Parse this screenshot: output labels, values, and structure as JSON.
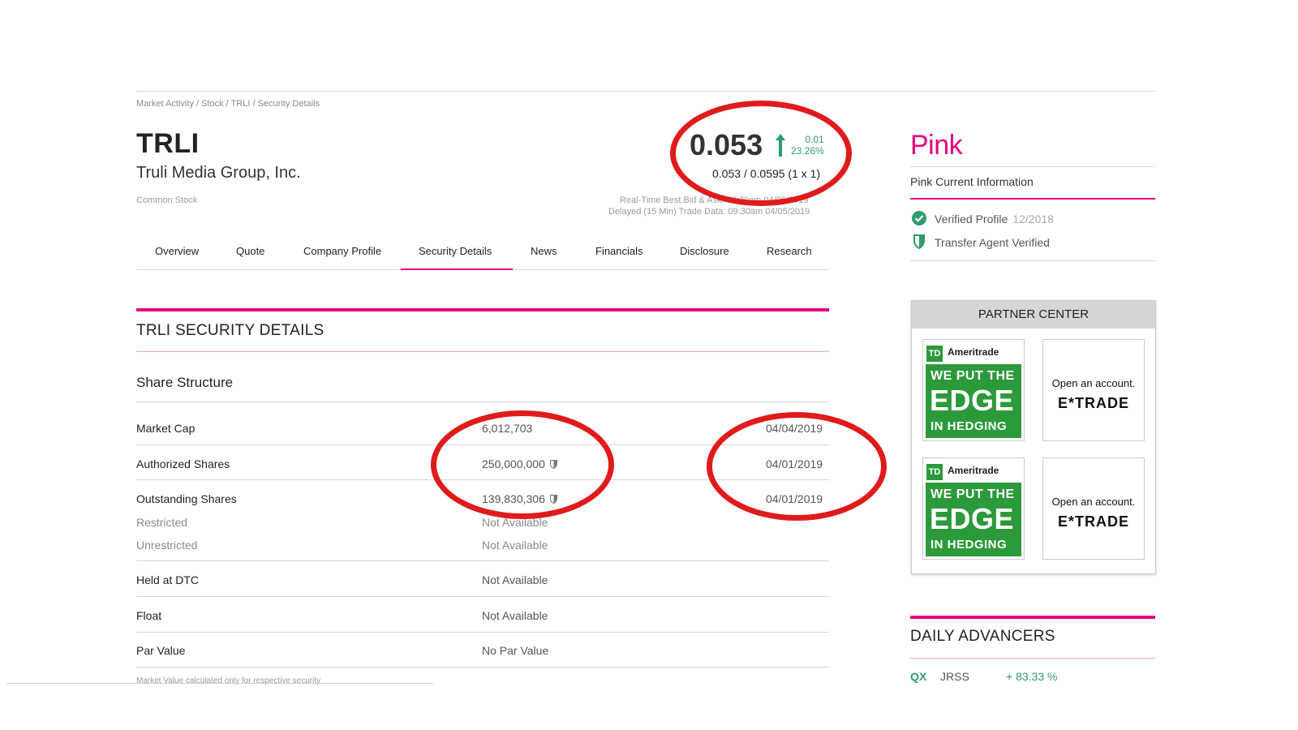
{
  "breadcrumb": [
    "Market Activity",
    "Stock",
    "TRLI",
    "Security Details"
  ],
  "breadcrumb_sep": " / ",
  "header": {
    "ticker": "TRLI",
    "company": "Truli Media Group, Inc.",
    "security_type": "Common Stock",
    "price": "0.053",
    "change": "0.01",
    "change_pct": "23.26%",
    "bid_ask": "0.053 / 0.0595 (1 x 1)",
    "realtime_note": "Real-Time Best Bid & Ask: 09:30am 04/05/2019",
    "delayed_note": "Delayed (15 Min) Trade Data: 09:30am 04/05/2019",
    "up_color": "#2e9d6a"
  },
  "tabs": [
    "Overview",
    "Quote",
    "Company Profile",
    "Security Details",
    "News",
    "Financials",
    "Disclosure",
    "Research"
  ],
  "active_tab": "Security Details",
  "security_details": {
    "title": "TRLI SECURITY DETAILS",
    "share_structure_title": "Share Structure",
    "rows": {
      "market_cap": {
        "label": "Market Cap",
        "value": "6,012,703",
        "date": "04/04/2019"
      },
      "authorized": {
        "label": "Authorized Shares",
        "value": "250,000,000",
        "date": "04/01/2019"
      },
      "outstanding": {
        "label": "Outstanding Shares",
        "value": "139,830,306",
        "date": "04/01/2019"
      },
      "restricted": {
        "label": "Restricted",
        "value": "Not Available"
      },
      "unrestricted": {
        "label": "Unrestricted",
        "value": "Not Available"
      },
      "held_dtc": {
        "label": "Held at DTC",
        "value": "Not Available"
      },
      "float": {
        "label": "Float",
        "value": "Not Available"
      },
      "par_value": {
        "label": "Par Value",
        "value": "No Par Value"
      }
    },
    "footnote": "Market Value calculated only for respective security"
  },
  "sidebar": {
    "tier_logo": "Pink",
    "tier_info": "Pink Current Information",
    "verified_profile": "Verified Profile",
    "verified_date": "12/2018",
    "transfer_agent": "Transfer Agent Verified",
    "brand_color": "#e5007e"
  },
  "partner_center": {
    "title": "PARTNER CENTER",
    "ads": [
      {
        "brand": "Ameritrade",
        "logo": "TD",
        "line1": "WE PUT THE",
        "line2": "EDGE",
        "line3": "IN HEDGING"
      },
      {
        "line1": "Open an account.",
        "brand": "E*TRADE"
      },
      {
        "brand": "Ameritrade",
        "logo": "TD",
        "line1": "WE PUT THE",
        "line2": "EDGE",
        "line3": "IN HEDGING"
      },
      {
        "line1": "Open an account.",
        "brand": "E*TRADE"
      }
    ]
  },
  "daily_advancers": {
    "title": "DAILY ADVANCERS",
    "items": [
      {
        "market": "QX",
        "symbol": "JRSS",
        "change": "+ 83.33 %"
      }
    ]
  }
}
